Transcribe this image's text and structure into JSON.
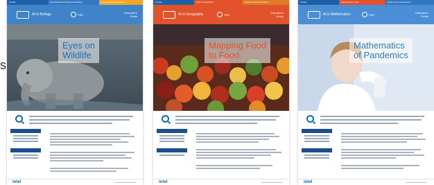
{
  "edge_fragment": "s.",
  "cards": [
    {
      "title_line1": "Eyes on",
      "title_line2": "Wildlife",
      "program": "AI in Biology",
      "partner": "PBS",
      "guide_label_1": "Educator's",
      "guide_label_2": "Guide",
      "tabs": [
        "Grades",
        "Computational Thinking & Modeling",
        "Grade-Level Connections"
      ],
      "brand": "intel",
      "colors": {
        "band": "#3f83c9",
        "tab1": "#1f5fa6",
        "tab2": "#3478c2",
        "tab3": "#f5a623"
      }
    },
    {
      "title_line1": "Mapping Food",
      "title_line2": "to Food",
      "program": "AI in Geography",
      "partner": "PBS",
      "guide_label_1": "Educator's",
      "guide_label_2": "Guide",
      "tabs": [
        "Grades",
        "Data & Geography",
        "Grade-Level Connections"
      ],
      "brand": "intel",
      "colors": {
        "band": "#e2522b",
        "tab1": "#1f5fa6",
        "tab2": "#e2522b",
        "tab3": "#e07b2a"
      }
    },
    {
      "title_line1": "Mathematics",
      "title_line2": "of Pandemics",
      "program": "AI in Mathematics",
      "partner": "PBS",
      "guide_label_1": "Educator's",
      "guide_label_2": "Guide",
      "tabs": [
        "Grades",
        "Data Science Tools",
        "Grade-Level Connections"
      ],
      "brand": "intel",
      "colors": {
        "band": "#4a8fd6",
        "tab1": "#1f5fa6",
        "tab2": "#e2522b",
        "tab3": "#3478c2"
      }
    }
  ]
}
